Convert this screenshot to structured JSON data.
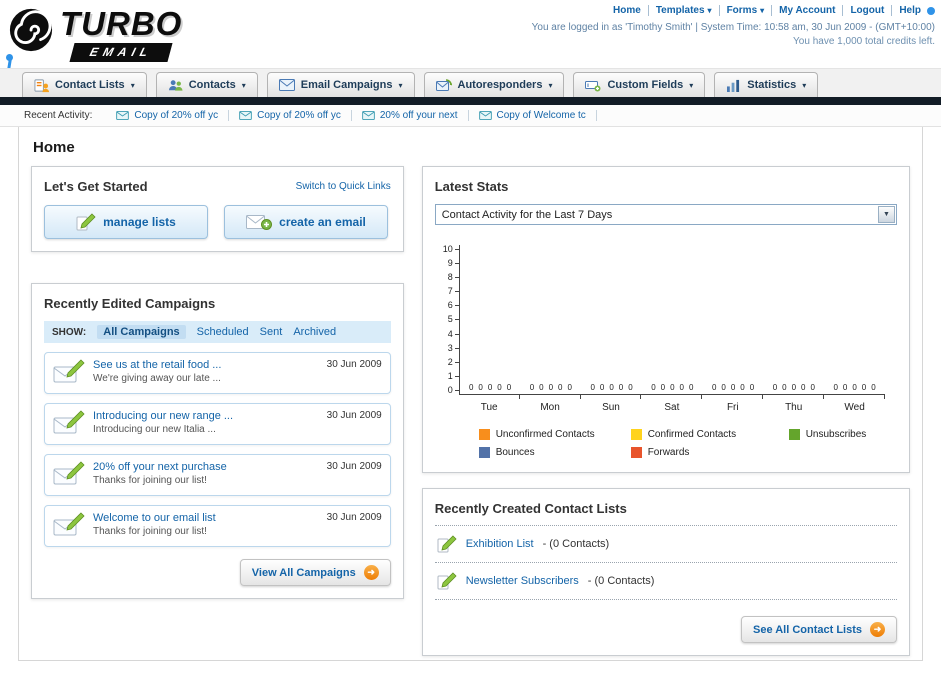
{
  "header": {
    "logo_primary": "TURBO",
    "logo_secondary": "EMAIL",
    "links": [
      {
        "label": "Home"
      },
      {
        "label": "Templates",
        "dropdown": true
      },
      {
        "label": "Forms",
        "dropdown": true
      },
      {
        "label": "My Account"
      },
      {
        "label": "Logout"
      },
      {
        "label": "Help"
      }
    ],
    "session_info": "You are logged in as 'Timothy Smith' | System Time: 10:58 am, 30 Jun 2009 - (GMT+10:00)",
    "credits_info": "You have 1,000 total credits left."
  },
  "nav": {
    "items": [
      {
        "label": "Contact Lists"
      },
      {
        "label": "Contacts"
      },
      {
        "label": "Email Campaigns"
      },
      {
        "label": "Autoresponders"
      },
      {
        "label": "Custom Fields"
      },
      {
        "label": "Statistics"
      }
    ]
  },
  "recent_activity": {
    "label": "Recent Activity:",
    "items": [
      "Copy of 20% off yc",
      "Copy of 20% off yc",
      "20% off your next",
      "Copy of Welcome tc"
    ]
  },
  "page_title": "Home",
  "get_started": {
    "title": "Let's Get Started",
    "switch_link": "Switch to Quick Links",
    "manage_lists_button": "manage lists",
    "create_email_button": "create an email"
  },
  "campaigns": {
    "title": "Recently Edited Campaigns",
    "show_label": "SHOW:",
    "tabs": [
      "All Campaigns",
      "Scheduled",
      "Sent",
      "Archived"
    ],
    "active_tab": "All Campaigns",
    "items": [
      {
        "title": "See us at the retail food ...",
        "subtitle": "We're giving away our late ...",
        "date": "30 Jun 2009"
      },
      {
        "title": "Introducing our new range ...",
        "subtitle": "Introducing our new Italia ...",
        "date": "30 Jun 2009"
      },
      {
        "title": "20% off your next purchase",
        "subtitle": "Thanks for joining our list!",
        "date": "30 Jun 2009"
      },
      {
        "title": "Welcome to our email list",
        "subtitle": "Thanks for joining our list!",
        "date": "30 Jun 2009"
      }
    ],
    "view_all_button": "View All Campaigns"
  },
  "stats": {
    "title": "Latest Stats",
    "selector_value": "Contact Activity for the Last 7 Days"
  },
  "chart_data": {
    "type": "bar",
    "title": "Contact Activity for the Last 7 Days",
    "categories": [
      "Tue",
      "Mon",
      "Sun",
      "Sat",
      "Fri",
      "Thu",
      "Wed"
    ],
    "series": [
      {
        "name": "Unconfirmed Contacts",
        "color": "#f88e1c",
        "values": [
          0,
          0,
          0,
          0,
          0,
          0,
          0
        ]
      },
      {
        "name": "Confirmed Contacts",
        "color": "#ffd31c",
        "values": [
          0,
          0,
          0,
          0,
          0,
          0,
          0
        ]
      },
      {
        "name": "Unsubscribes",
        "color": "#64a52c",
        "values": [
          0,
          0,
          0,
          0,
          0,
          0,
          0
        ]
      },
      {
        "name": "Bounces",
        "color": "#5272a8",
        "values": [
          0,
          0,
          0,
          0,
          0,
          0,
          0
        ]
      },
      {
        "name": "Forwards",
        "color": "#e8542c",
        "values": [
          0,
          0,
          0,
          0,
          0,
          0,
          0
        ]
      }
    ],
    "ylim": [
      0,
      10
    ],
    "yticks": [
      0,
      1,
      2,
      3,
      4,
      5,
      6,
      7,
      8,
      9,
      10
    ],
    "grid": false,
    "legend_position": "bottom"
  },
  "contact_lists": {
    "title": "Recently Created Contact Lists",
    "items": [
      {
        "name": "Exhibition List",
        "suffix": "- (0 Contacts)"
      },
      {
        "name": "Newsletter Subscribers",
        "suffix": "- (0 Contacts)"
      }
    ],
    "see_all_button": "See All Contact Lists"
  },
  "icons": {
    "caret": "▾",
    "select_arrow": "▼",
    "button_arrow": "➜"
  },
  "colors": {
    "accent_blue": "#1464a8",
    "dark_bar": "#121c26",
    "orange": "#ee7d04"
  }
}
